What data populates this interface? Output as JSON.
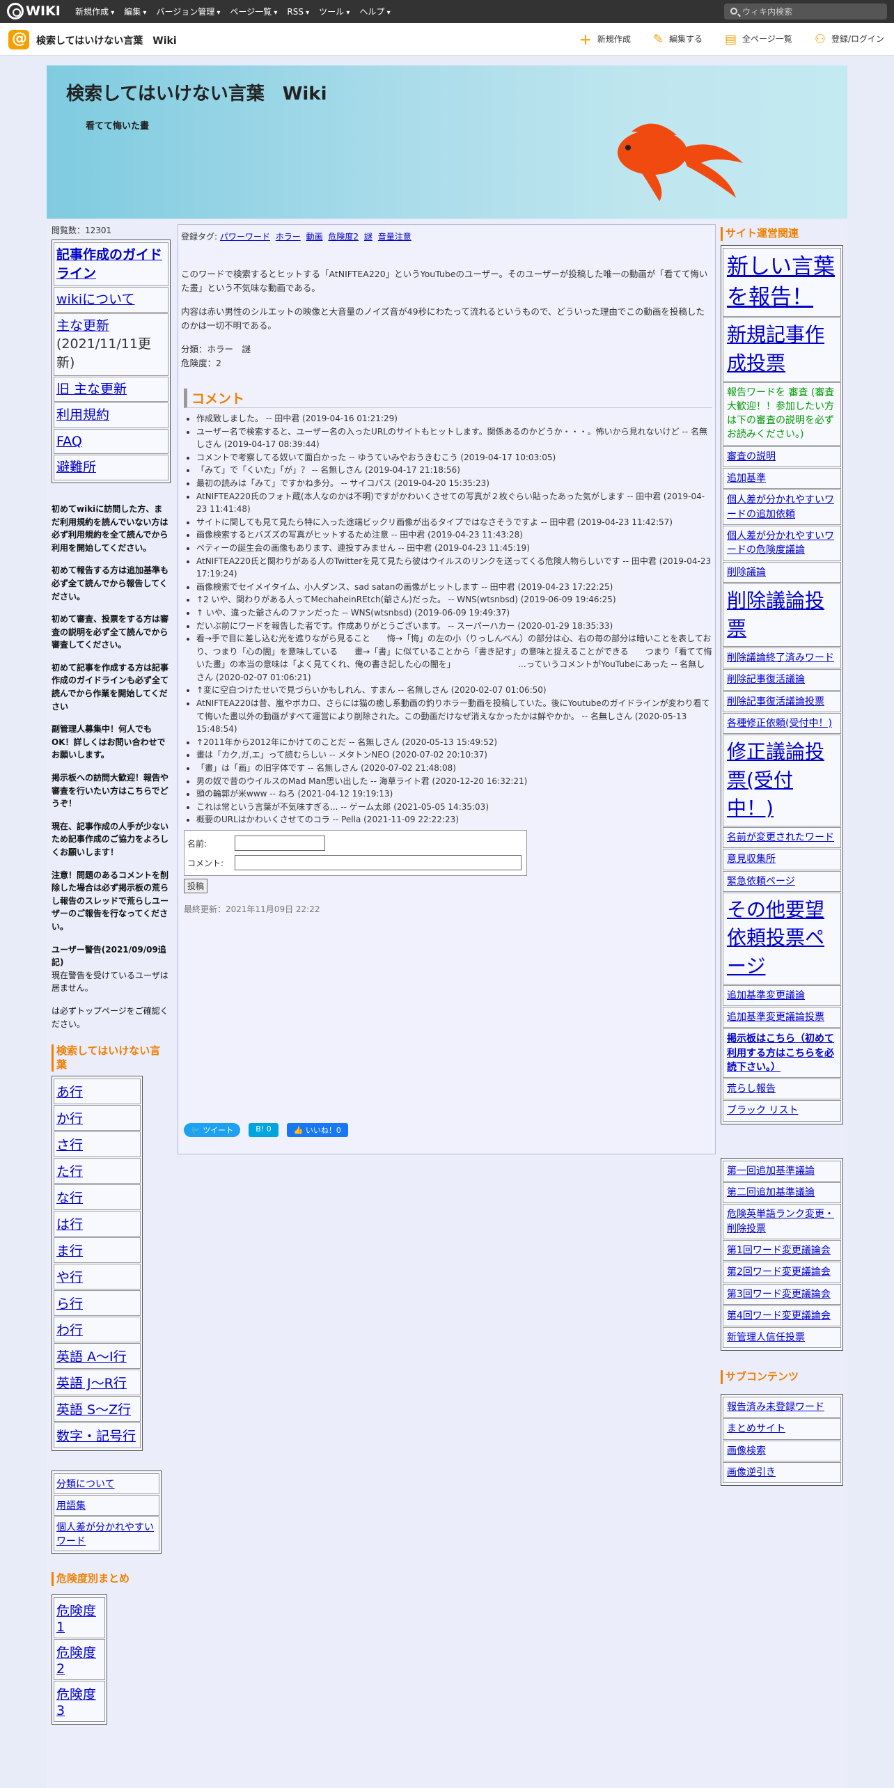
{
  "topbar": {
    "logo": "WIKI",
    "menu": [
      "新規作成",
      "編集",
      "バージョン管理",
      "ページ一覧",
      "RSS",
      "ツール",
      "ヘルプ"
    ],
    "search_placeholder": "ウィキ内検索"
  },
  "subbar": {
    "site": "検索してはいけない言葉　Wiki",
    "actions": [
      "新規作成",
      "編集する",
      "全ページ一覧",
      "登録/ログイン"
    ]
  },
  "header": {
    "title": "検索してはいけない言葉　Wiki",
    "subtitle": "看てて悔いた畫"
  },
  "left": {
    "counter": "閲覧数：12301",
    "nav": [
      "記事作成のガイドライン",
      "wikiについて",
      "主な更新",
      "(2021/11/11更新)",
      "旧 主な更新",
      "利用規約",
      "FAQ",
      "避難所"
    ],
    "notes": [
      "初めてwikiに訪問した方、まだ利用規約を読んでいない方は必ず利用規約を全て読んでから利用を開始してください。",
      "初めて報告する方は追加基準も必ず全て読んでから報告してください。",
      "初めて審査、投票をする方は審査の説明を必ず全て読んでから審査してください。",
      "初めて記事を作成する方は記事作成のガイドラインも必ず全て読んでから作業を開始してください",
      "副管理人募集中！何人でもOK！詳しくはお問い合わせでお願いします。",
      "掲示板への訪問大歓迎！報告や審査を行いたい方はこちらでどうぞ！",
      "現在、記事作成の人手が少ないため記事作成のご協力をよろしくお願いします！",
      "注意！問題のあるコメントを削除した場合は必ず掲示板の荒らし報告のスレッドで荒らしユーザーのご報告を行なってください。",
      "ユーザー警告(2021/09/09追記)"
    ],
    "warn_text": "現在警告を受けているユーザは居ません。",
    "warn_text2": "は必ずトップページをご確認ください。",
    "sect1": "検索してはいけない言葉",
    "gyo": [
      "あ行",
      "か行",
      "さ行",
      "た行",
      "な行",
      "は行",
      "ま行",
      "や行",
      "ら行",
      "わ行",
      "英語 A〜I行",
      "英語 J〜R行",
      "英語 S〜Z行",
      "数字・記号行"
    ],
    "small": [
      "分類について",
      "用語集",
      "個人差が分かれやすいワード"
    ],
    "sect2": "危険度別まとめ",
    "danger": [
      "危険度1",
      "危険度2",
      "危険度3"
    ]
  },
  "main": {
    "tags_label": "登録タグ:",
    "tags": [
      "パワーワード",
      "ホラー",
      "動画",
      "危険度2",
      "謎",
      "音量注意"
    ],
    "p1": "このワードで検索するとヒットする「AtNIFTEA220」というYouTubeのユーザー。そのユーザーが投稿した唯一の動画が「看てて悔いた畫」という不気味な動画である。",
    "p2": "内容は赤い男性のシルエットの映像と大音量のノイズ音が49秒にわたって流れるというもので、どういった理由でこの動画を投稿したのかは一切不明である。",
    "p3a": "分類：ホラー　謎",
    "p3b": "危険度：2",
    "comment_head": "コメント",
    "comments": [
      "作成致しました。 -- 田中君 (2019-04-16 01:21:29)",
      "ユーザー名で検索すると、ユーザー名の入ったURLのサイトもヒットします。関係あるのかどうか・・・。怖いから見れないけど -- 名無しさん (2019-04-17 08:39:44)",
      "コメントで考察してる奴いて面白かった -- ゆうていみやおうきむこう (2019-04-17 10:03:05)",
      "「みて」で「くいた」「が」？ -- 名無しさん (2019-04-17 21:18:56)",
      "最初の読みは「みて」ですかね多分。 -- サイコパス (2019-04-20 15:35:23)",
      "AtNIFTEA220氏のフォト蔵(本人なのかは不明)ですがかわいくさせての写真が２枚ぐらい貼ったあった気がします -- 田中君 (2019-04-23 11:41:48)",
      "サイトに関しても見て見たら特に入った途端ビックリ画像が出るタイプではなさそうですよ -- 田中君 (2019-04-23 11:42:57)",
      "画像検索するとバズズの写真がヒットするため注意 -- 田中君 (2019-04-23 11:43:28)",
      "@@ペティーの誕生会の画像もあります、連投すみません -- 田中君 (2019-04-23 11:45:19)",
      "AtNIFTEA220氏と関わりがある人のTwitterを見て見たら彼はウイルスのリンクを送ってくる危険人物らしいです -- 田中君 (2019-04-23 17:19:24)",
      "@@画像検索でセイメイタイム、小人ダンス、sad satanの画像がヒットします -- 田中君 (2019-04-23 17:22:25)",
      "↑2 いや、関わりがある人ってMechaheinREtch(爺さん)だった。 -- WNS(wtsnbsd) (2019-06-09 19:46:25)",
      "↑ いや、違った爺さんのファンだった -- WNS(wtsnbsd) (2019-06-09 19:49:37)",
      "だいぶ前にワードを報告した者です。作成ありがとうございます。 -- スーパーハカー (2020-01-29 18:35:33)",
      "看→手で目に差し込む光を遮りながら見ること　　悔→「悔」の左の小（りっしんべん）の部分は心、右の毎の部分は暗いことを表しており、つまり「心の闇」を意味している　　畫→「書」に似ていることから「書き記す」の意味と捉えることができる　　つまり「看てて悔いた畫」の本当の意味は「よく見てくれ、俺の書き記した心の闇を」　　　　　　　　…っていうコメントがYouTubeにあった -- 名無しさん (2020-02-07 01:06:21)",
      "↑変に空白つけたせいで見づらいかもしれん、すまん -- 名無しさん (2020-02-07 01:06:50)",
      "AtNIFTEA220は昔、嵐やボカロ、さらには猫の癒し系動画の釣りホラー動画を投稿していた。後にYoutubeのガイドラインが変わり看てて悔いた畫以外の動画がすべて運営により削除された。この動画だけなぜ消えなかったかは鮮やかか。 -- 名無しさん (2020-05-13 15:48:54)",
      "↑2011年から2012年にかけてのことだ -- 名無しさん (2020-05-13 15:49:52)",
      "畫は「カク,ガ,エ」って読むらしい -- メタトンNEO (2020-07-02 20:10:37)",
      "「畫」は「画」の旧字体です -- 名無しさん (2020-07-02 21:48:08)",
      "男の奴で昔のウイルスのMad Man思い出した -- 海草ライト君 (2020-12-20 16:32:21)",
      "頭の輪郭が米www -- ねろ (2021-04-12 19:19:13)",
      "これは常という言葉が不気味すぎる... -- ゲーム太郎 (2021-05-05 14:35:03)",
      "概要のURLはかわいくさせてのコラ -- Pella (2021-11-09 22:22:23)"
    ],
    "form_name": "名前:",
    "form_comment": "コメント:",
    "post": "投稿",
    "lastmod": "最終更新：2021年11月09日 22:22",
    "social": [
      "ツイート",
      "B! 0",
      "いいね！0"
    ]
  },
  "right": {
    "head": "サイト運営関連",
    "items": [
      {
        "t": "新しい言葉を報告！",
        "c": "huge"
      },
      {
        "t": "新規記事作成投票",
        "c": "big"
      },
      {
        "t": "報告ワードを 審査 (審査大歓迎！！参加したい方は下の審査の説明を必ずお読みください。)",
        "c": "mixgreen"
      },
      {
        "t": "審査の説明",
        "c": ""
      },
      {
        "t": "追加基準",
        "c": ""
      },
      {
        "t": "個人差が分かれやすいワードの追加依頼",
        "c": ""
      },
      {
        "t": "個人差が分かれやすいワードの危険度議論",
        "c": ""
      },
      {
        "t": "削除議論",
        "c": ""
      },
      {
        "t": "削除議論投票",
        "c": "big"
      },
      {
        "t": "削除議論終了済みワード",
        "c": ""
      },
      {
        "t": "削除記事復活議論",
        "c": ""
      },
      {
        "t": "削除記事復活議論投票",
        "c": ""
      },
      {
        "t": "各種修正依頼(受付中！)",
        "c": "green"
      },
      {
        "t": "修正議論投票(受付中！)",
        "c": "biggreen"
      },
      {
        "t": "名前が変更されたワード",
        "c": ""
      },
      {
        "t": "意見収集所",
        "c": ""
      },
      {
        "t": "緊急依頼ページ",
        "c": ""
      },
      {
        "t": "その他要望依頼投票ページ",
        "c": "big"
      },
      {
        "t": "追加基準変更議論",
        "c": ""
      },
      {
        "t": "追加基準変更議論投票",
        "c": ""
      },
      {
        "t": "掲示板はこちら（初めて利用する方はこちらを必読下さい。）",
        "c": "bbs"
      },
      {
        "t": "荒らし報告",
        "c": ""
      },
      {
        "t": "ブラック リスト",
        "c": ""
      }
    ],
    "items2": [
      "第一回追加基準議論",
      "第二回追加基準議論",
      "危険英単語ランク変更・削除投票",
      "第1回ワード変更議論会",
      "第2回ワード変更議論会",
      "第3回ワード変更議論会",
      "第4回ワード変更議論会",
      "新管理人信任投票"
    ],
    "head2": "サブコンテンツ",
    "items3": [
      "報告済み未登録ワード",
      "まとめサイト",
      "画像検索",
      "画像逆引き"
    ]
  }
}
